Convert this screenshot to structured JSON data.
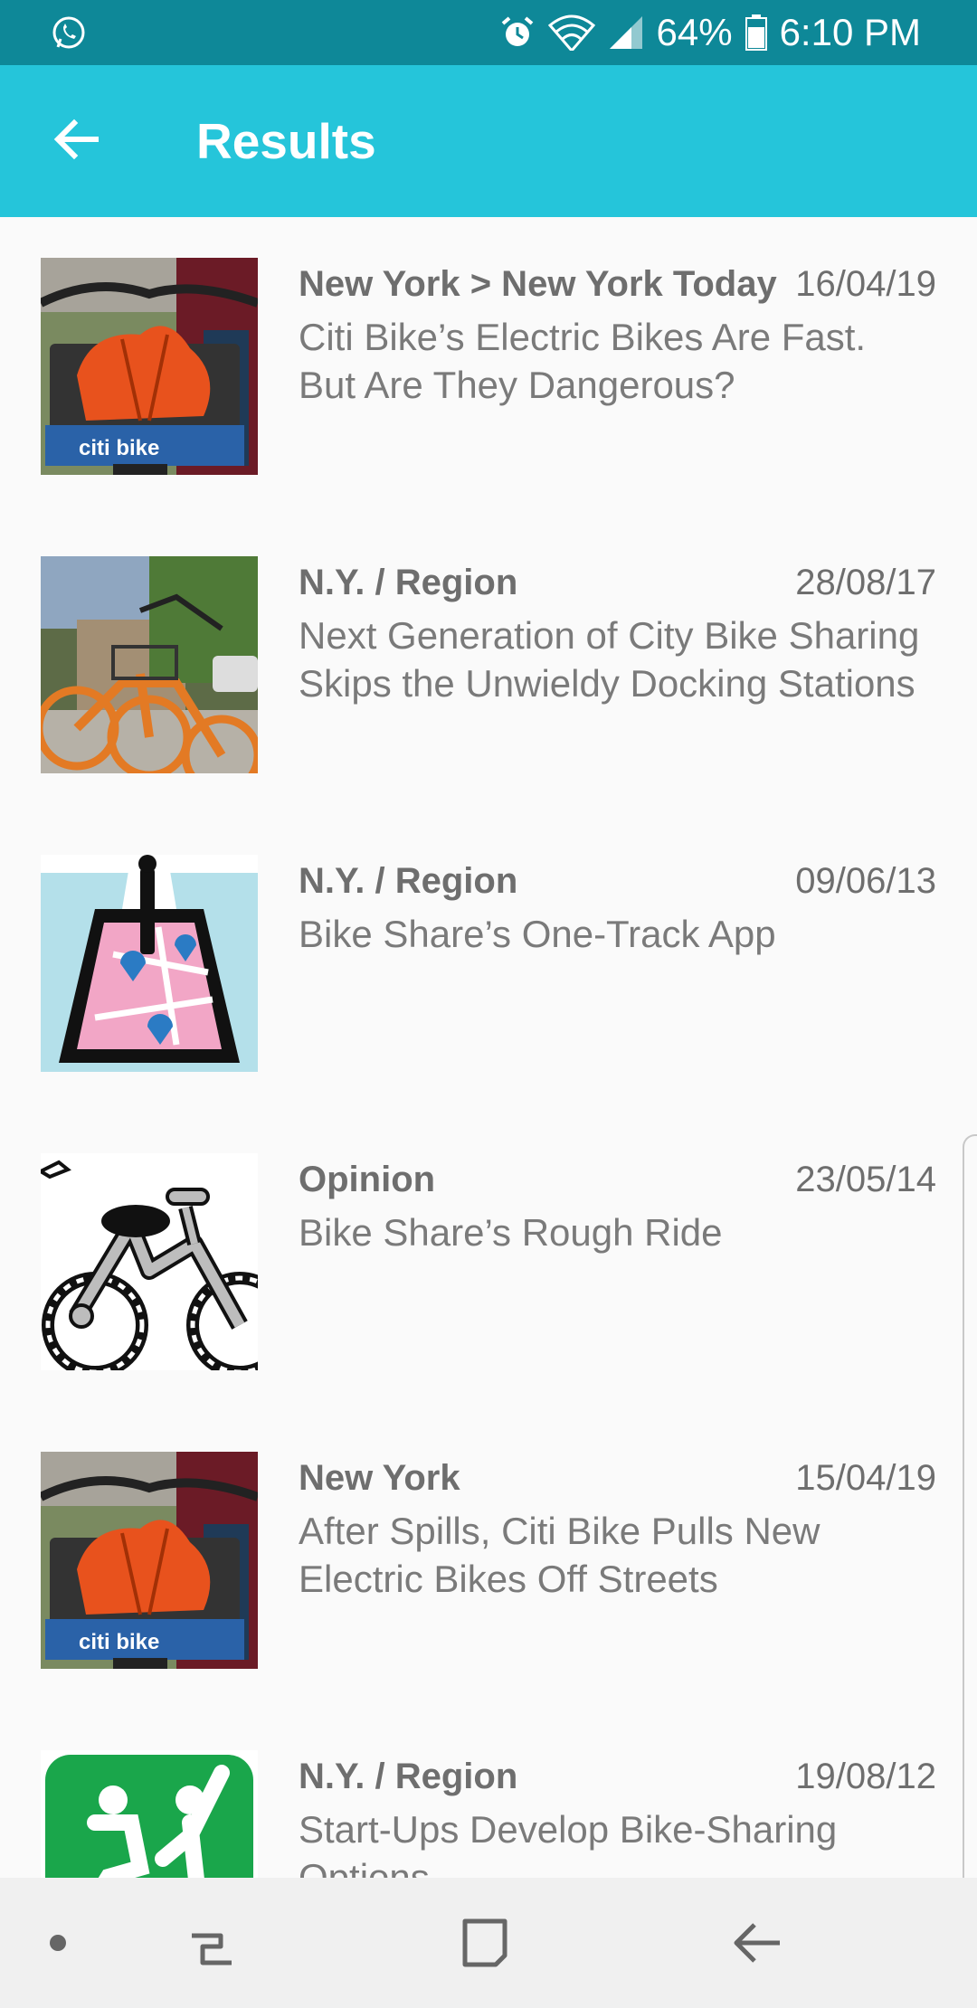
{
  "status_bar": {
    "battery": "64%",
    "time": "6:10 PM",
    "icons": [
      "whatsapp-icon",
      "alarm-icon",
      "wifi-icon",
      "signal-icon",
      "battery-icon"
    ]
  },
  "app_bar": {
    "title": "Results",
    "back_icon": "arrow-back-icon"
  },
  "results": [
    {
      "section": "New York > New York Today",
      "date": "16/04/19",
      "headline": "Citi Bike’s Electric Bikes Are Fast. But Are They Dangerous?"
    },
    {
      "section": "N.Y. / Region",
      "date": "28/08/17",
      "headline": "Next Generation of City Bike Sharing Skips the Unwieldy Docking Stations"
    },
    {
      "section": "N.Y. / Region",
      "date": "09/06/13",
      "headline": "Bike Share’s One-Track App"
    },
    {
      "section": "Opinion",
      "date": "23/05/14",
      "headline": "Bike Share’s Rough Ride"
    },
    {
      "section": "New York",
      "date": "15/04/19",
      "headline": "After Spills, Citi Bike Pulls New Electric Bikes Off Streets"
    },
    {
      "section": "N.Y. / Region",
      "date": "19/08/12",
      "headline": "Start-Ups Develop Bike-Sharing Options"
    }
  ],
  "thumb_text": {
    "citibike_logo": "citi bike"
  },
  "nav_bar": {
    "icons": [
      "dot-icon",
      "recents-icon",
      "home-icon",
      "back-icon"
    ]
  },
  "colors": {
    "status_bar": "#0e8898",
    "app_bar": "#25c5da",
    "background": "#fafafa",
    "text": "#7a7a7a"
  }
}
